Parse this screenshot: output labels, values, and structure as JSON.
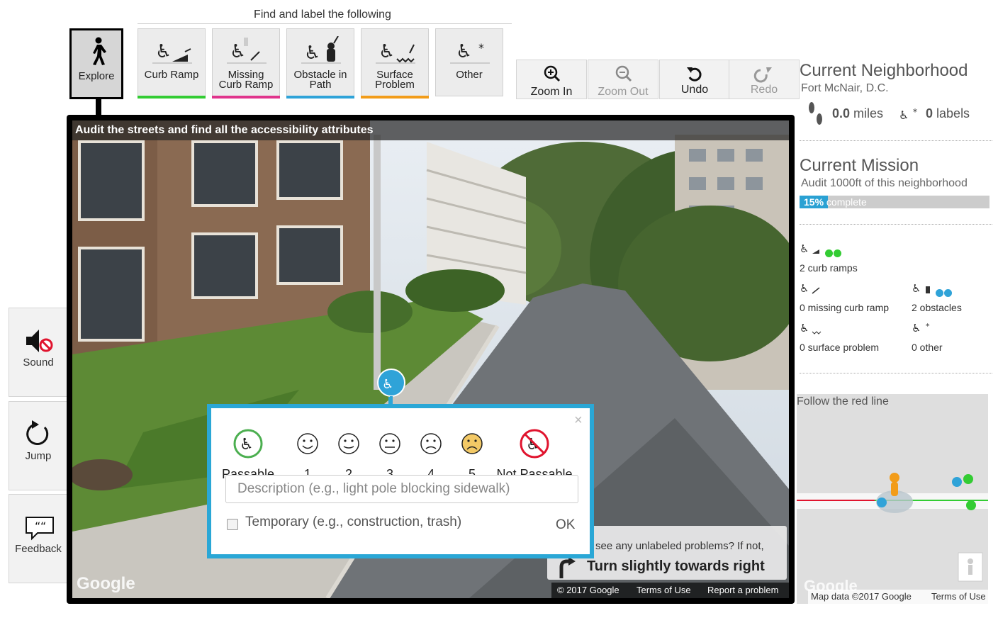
{
  "toolbar": {
    "find_title": "Find and label the following",
    "explore_label": "Explore",
    "tools": [
      {
        "label1": "Curb Ramp",
        "label2": "",
        "color": "#33cc33",
        "icon": "curb-ramp-icon"
      },
      {
        "label1": "Missing",
        "label2": "Curb Ramp",
        "color": "#e0348c",
        "icon": "missing-curb-ramp-icon"
      },
      {
        "label1": "Obstacle in",
        "label2": "Path",
        "color": "#2fa3d8",
        "icon": "obstacle-icon"
      },
      {
        "label1": "Surface",
        "label2": "Problem",
        "color": "#f29c19",
        "icon": "surface-problem-icon"
      },
      {
        "label1": "Other",
        "label2": "",
        "color": "",
        "icon": "other-icon"
      }
    ],
    "zoom_in": "Zoom In",
    "zoom_out": "Zoom Out",
    "undo": "Undo",
    "redo": "Redo"
  },
  "pano": {
    "header": "Audit the streets and find all the accessibility attributes",
    "google_logo": "Google",
    "copyright": "© 2017 Google",
    "terms": "Terms of Use",
    "report": "Report a problem"
  },
  "popup": {
    "close": "×",
    "severity": [
      {
        "label": "Passable"
      },
      {
        "label": "1"
      },
      {
        "label": "2"
      },
      {
        "label": "3"
      },
      {
        "label": "4"
      },
      {
        "label": "5"
      },
      {
        "label": "Not Passable"
      }
    ],
    "description_placeholder": "Description (e.g., light pole blocking sidewalk)",
    "temporary_label": "Temporary (e.g., construction, trash)",
    "ok": "OK"
  },
  "nav_hint": {
    "question": "see any unlabeled problems? If not,",
    "direction": "Turn slightly towards right"
  },
  "side": {
    "sound": "Sound",
    "jump": "Jump",
    "feedback": "Feedback"
  },
  "neighborhood": {
    "heading": "Current Neighborhood",
    "name": "Fort McNair, D.C.",
    "miles_value": "0.0",
    "miles_unit": "miles",
    "labels_value": "0",
    "labels_unit": "labels"
  },
  "mission": {
    "heading": "Current Mission",
    "text": "Audit 1000ft of this neighborhood",
    "progress_text": "15%",
    "progress_suffix": "complete",
    "progress_fraction": 0.15
  },
  "label_counts": {
    "curb_ramps": "2 curb ramps",
    "missing_curb_ramp": "0 missing curb ramp",
    "obstacles": "2 obstacles",
    "surface_problem": "0 surface problem",
    "other": "0 other"
  },
  "minimap": {
    "title": "Follow the red line",
    "google_logo": "Google",
    "map_data": "Map data ©2017 Google",
    "terms": "Terms of Use"
  },
  "colors": {
    "accent_blue": "#2aa7d6",
    "progress_blue": "#2aa1d3",
    "curb_green": "#33cc33",
    "missing_pink": "#e0348c",
    "obstacle_blue": "#2fa3d8",
    "surface_orange": "#f29c19"
  }
}
